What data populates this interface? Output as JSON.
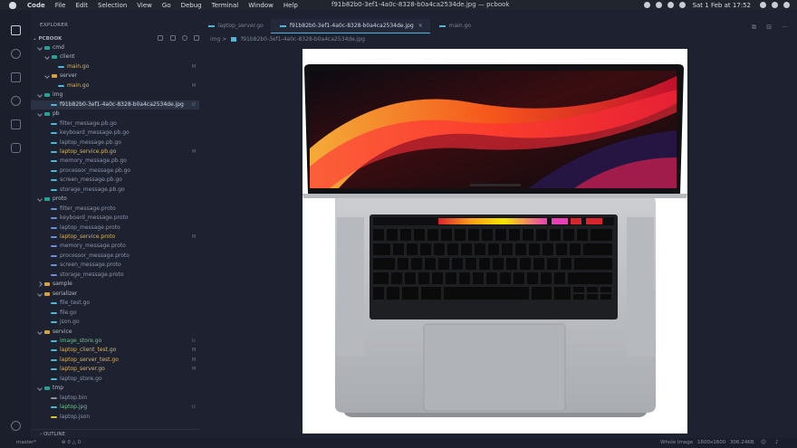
{
  "menubar": {
    "items": [
      "Code",
      "File",
      "Edit",
      "Selection",
      "View",
      "Go",
      "Debug",
      "Terminal",
      "Window",
      "Help"
    ],
    "window_title": "f91b82b0-3ef1-4a0c-8328-b0a4ca2534de.jpg — pcbook",
    "clock": "Sat 1 Feb at 17:52"
  },
  "sidebar": {
    "header": "EXPLORER",
    "project": "PCBOOK",
    "tree": [
      {
        "label": "cmd",
        "type": "folder",
        "depth": 1,
        "open": true,
        "badge": ""
      },
      {
        "label": "client",
        "type": "folder",
        "depth": 2,
        "open": true,
        "badge": ""
      },
      {
        "label": "main.go",
        "type": "go",
        "depth": 3,
        "badge": "M"
      },
      {
        "label": "server",
        "type": "folder",
        "depth": 2,
        "open": true,
        "badge": ""
      },
      {
        "label": "main.go",
        "type": "go",
        "depth": 3,
        "badge": "M"
      },
      {
        "label": "img",
        "type": "folder",
        "depth": 1,
        "open": true,
        "badge": ""
      },
      {
        "label": "f91b82b0-3ef1-4a0c-8328-b0a4ca2534de.jpg",
        "type": "img",
        "depth": 2,
        "badge": "U",
        "selected": true
      },
      {
        "label": "pb",
        "type": "folder",
        "depth": 1,
        "open": true,
        "badge": ""
      },
      {
        "label": "filter_message.pb.go",
        "type": "go",
        "depth": 2,
        "badge": ""
      },
      {
        "label": "keyboard_message.pb.go",
        "type": "go",
        "depth": 2,
        "badge": ""
      },
      {
        "label": "laptop_message.pb.go",
        "type": "go",
        "depth": 2,
        "badge": ""
      },
      {
        "label": "laptop_service.pb.go",
        "type": "go",
        "depth": 2,
        "badge": "M"
      },
      {
        "label": "memory_message.pb.go",
        "type": "go",
        "depth": 2,
        "badge": ""
      },
      {
        "label": "processor_message.pb.go",
        "type": "go",
        "depth": 2,
        "badge": ""
      },
      {
        "label": "screen_message.pb.go",
        "type": "go",
        "depth": 2,
        "badge": ""
      },
      {
        "label": "storage_message.pb.go",
        "type": "go",
        "depth": 2,
        "badge": ""
      },
      {
        "label": "proto",
        "type": "folder",
        "depth": 1,
        "open": true,
        "badge": ""
      },
      {
        "label": "filter_message.proto",
        "type": "proto",
        "depth": 2,
        "badge": ""
      },
      {
        "label": "keyboard_message.proto",
        "type": "proto",
        "depth": 2,
        "badge": ""
      },
      {
        "label": "laptop_message.proto",
        "type": "proto",
        "depth": 2,
        "badge": ""
      },
      {
        "label": "laptop_service.proto",
        "type": "proto",
        "depth": 2,
        "badge": "M"
      },
      {
        "label": "memory_message.proto",
        "type": "proto",
        "depth": 2,
        "badge": ""
      },
      {
        "label": "processor_message.proto",
        "type": "proto",
        "depth": 2,
        "badge": ""
      },
      {
        "label": "screen_message.proto",
        "type": "proto",
        "depth": 2,
        "badge": ""
      },
      {
        "label": "storage_message.proto",
        "type": "proto",
        "depth": 2,
        "badge": ""
      },
      {
        "label": "sample",
        "type": "folder",
        "depth": 1,
        "open": false,
        "badge": ""
      },
      {
        "label": "serializer",
        "type": "folder",
        "depth": 1,
        "open": true,
        "badge": ""
      },
      {
        "label": "file_test.go",
        "type": "go",
        "depth": 2,
        "badge": ""
      },
      {
        "label": "file.go",
        "type": "go",
        "depth": 2,
        "badge": ""
      },
      {
        "label": "json.go",
        "type": "go",
        "depth": 2,
        "badge": ""
      },
      {
        "label": "service",
        "type": "folder",
        "depth": 1,
        "open": true,
        "badge": ""
      },
      {
        "label": "image_store.go",
        "type": "go",
        "depth": 2,
        "badge": "U"
      },
      {
        "label": "laptop_client_test.go",
        "type": "go",
        "depth": 2,
        "badge": "M"
      },
      {
        "label": "laptop_server_test.go",
        "type": "go",
        "depth": 2,
        "badge": "M"
      },
      {
        "label": "laptop_server.go",
        "type": "go",
        "depth": 2,
        "badge": "M"
      },
      {
        "label": "laptop_store.go",
        "type": "go",
        "depth": 2,
        "badge": ""
      },
      {
        "label": "tmp",
        "type": "folder",
        "depth": 1,
        "open": true,
        "badge": ""
      },
      {
        "label": "laptop.bin",
        "type": "bin",
        "depth": 2,
        "badge": ""
      },
      {
        "label": "laptop.jpg",
        "type": "img",
        "depth": 2,
        "badge": "U"
      },
      {
        "label": "laptop.json",
        "type": "json",
        "depth": 2,
        "badge": ""
      }
    ],
    "outline_label": "OUTLINE"
  },
  "editor": {
    "tabs": [
      {
        "label": "laptop_server.go",
        "active": false
      },
      {
        "label": "f91b82b0-3ef1-4a0c-8328-b0a4ca2534de.jpg",
        "active": true
      },
      {
        "label": "main.go",
        "active": false
      }
    ],
    "breadcrumb_folder": "img",
    "breadcrumb_sep": ">",
    "breadcrumb_file": "f91b82b0-3ef1-4a0c-8328-b0a4ca2534de.jpg",
    "close_glyph": "×",
    "actions": [
      "⧉",
      "⊟",
      "···"
    ]
  },
  "statusbar": {
    "branch": "master*",
    "problems": "⊗ 0 △ 0",
    "mode": "Whole Image",
    "dimensions": "1600x1600",
    "size": "306.24KB"
  },
  "colors": {
    "folder_teal": "#21a39a",
    "folder_yellow": "#d8a23a",
    "go_icon": "#4fb6d6",
    "modified": "#6b7387"
  }
}
